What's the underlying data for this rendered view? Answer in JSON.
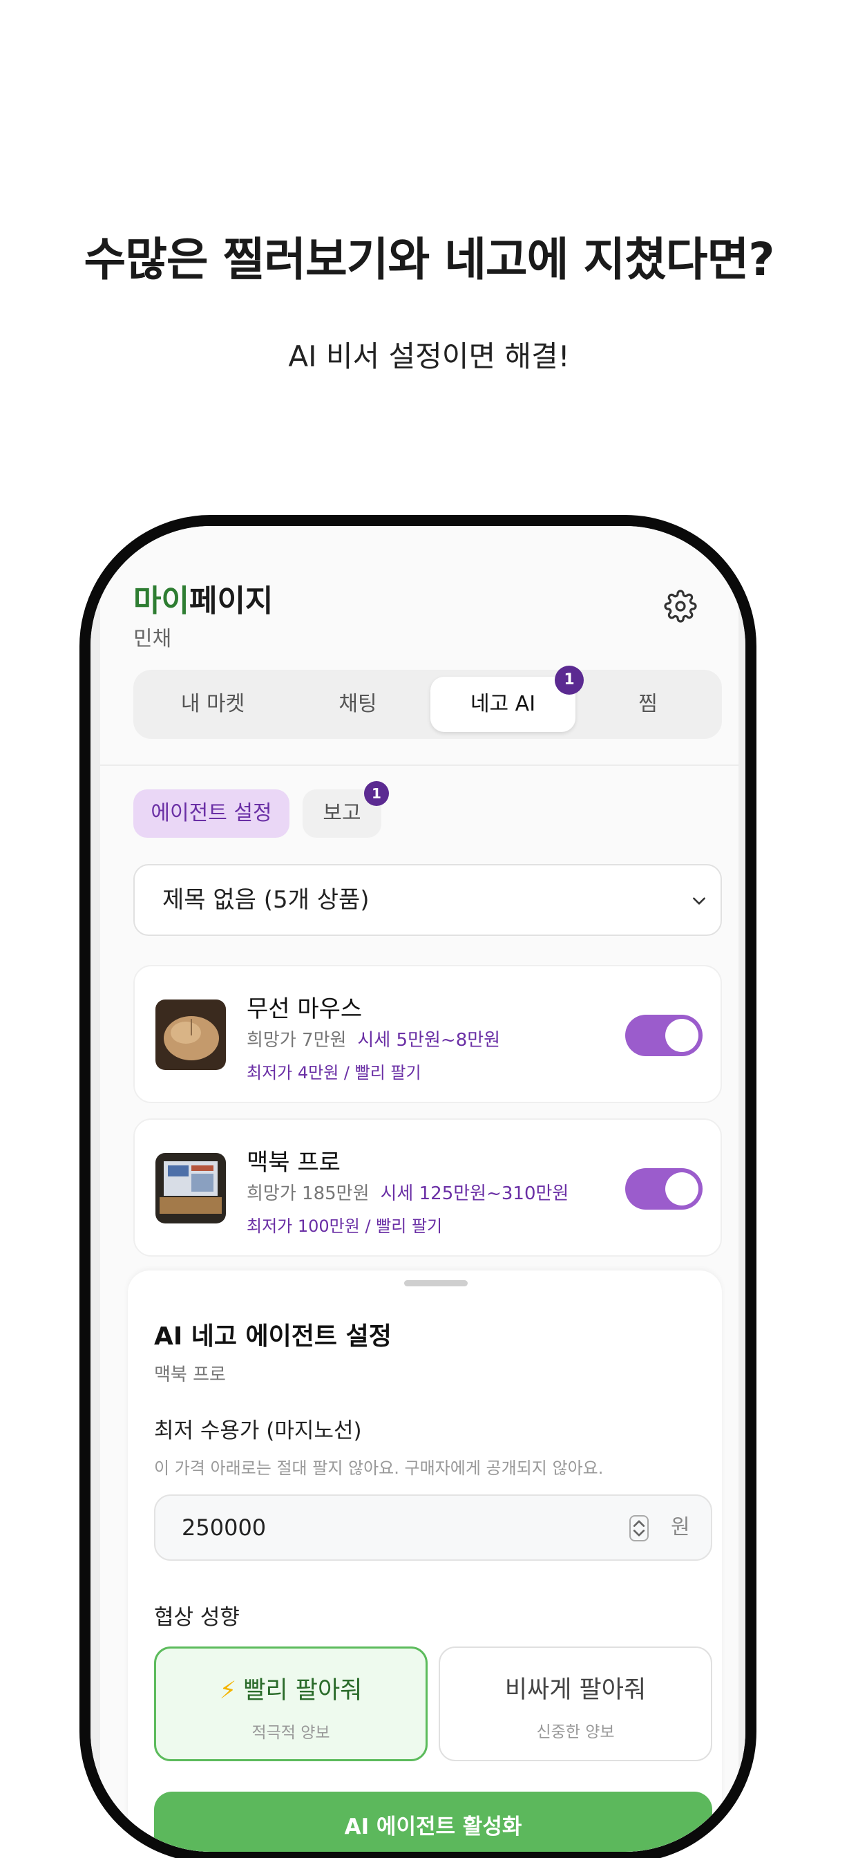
{
  "promo": {
    "headline": "수많은  찔러보기와 네고에 지쳤다면?",
    "subline": "AI 비서 설정이면  해결!"
  },
  "app": {
    "title_accent": "마이",
    "title_rest": "페이지",
    "user_name": "민채",
    "tabs": [
      {
        "label": "내 마켓"
      },
      {
        "label": "채팅"
      },
      {
        "label": "네고 AI",
        "badge": "1",
        "active": true
      },
      {
        "label": "찜"
      }
    ],
    "subtabs": [
      {
        "label": "에이전트 설정",
        "active": true
      },
      {
        "label": "보고",
        "badge": "1"
      }
    ],
    "select": {
      "value": "제목 없음 (5개 상품)"
    },
    "products": [
      {
        "name": "무선 마우스",
        "wish_price": "희망가 7만원",
        "market_price": "시세 5만원~8만원",
        "floor": "최저가 4만원 / 빨리 팔기",
        "enabled": true
      },
      {
        "name": "맥북 프로",
        "wish_price": "희망가 185만원",
        "market_price": "시세 125만원~310만원",
        "floor": "최저가 100만원 / 빨리 팔기",
        "enabled": true
      }
    ],
    "sheet": {
      "title": "AI 네고 에이전트 설정",
      "product": "맥북 프로",
      "floor_label": "최저 수용가 (마지노선)",
      "floor_help": "이 가격 아래로는 절대 팔지 않아요. 구매자에게 공개되지 않아요.",
      "floor_value": "250000",
      "unit": "원",
      "style_label": "협상 성향",
      "options": [
        {
          "title": "빨리 팔아줘",
          "sub": "적극적 양보",
          "icon": "lightning-icon",
          "selected": true
        },
        {
          "title": "비싸게 팔아줘",
          "sub": "신중한 양보",
          "selected": false
        }
      ],
      "cta": "AI 에이전트 활성화"
    }
  },
  "colors": {
    "accent_green": "#5cb85c",
    "accent_purple": "#6a2fa5",
    "badge": "#5b2a91",
    "toggle_on": "#9b5ccc"
  }
}
